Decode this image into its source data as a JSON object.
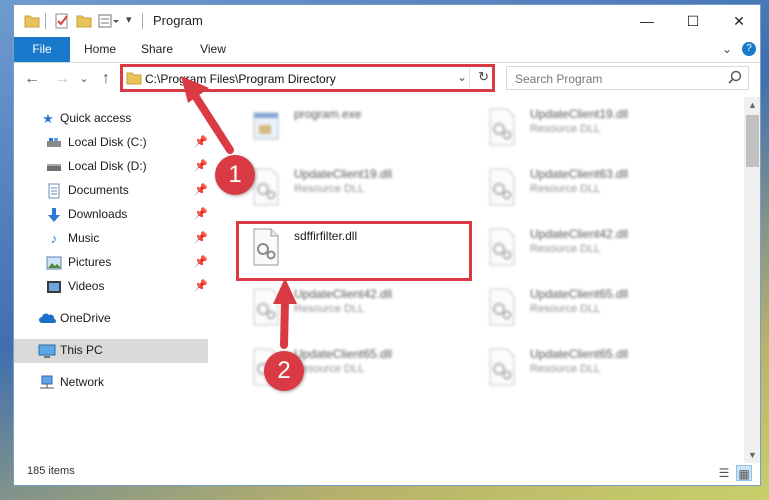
{
  "window": {
    "title": "Program",
    "controls": {
      "minimize": "—",
      "maximize": "☐",
      "close": "✕"
    }
  },
  "ribbon": {
    "tabs": [
      "File",
      "Home",
      "Share",
      "View"
    ],
    "expand": "⌄",
    "help": "?"
  },
  "nav": {
    "back": "←",
    "forward": "→",
    "recent": "⌄",
    "up": "↑",
    "address": "C:\\Program Files\\Program Directory",
    "dropdown": "⌄",
    "refresh": "↻",
    "search_placeholder": "Search Program"
  },
  "sidebar": {
    "items": [
      {
        "label": "Quick access",
        "icon": "star-icon"
      },
      {
        "label": "Local Disk (C:)",
        "icon": "drive-icon"
      },
      {
        "label": "Local Disk (D:)",
        "icon": "drive-icon"
      },
      {
        "label": "Documents",
        "icon": "documents-icon"
      },
      {
        "label": "Downloads",
        "icon": "download-icon"
      },
      {
        "label": "Music",
        "icon": "music-icon"
      },
      {
        "label": "Pictures",
        "icon": "pictures-icon"
      },
      {
        "label": "Videos",
        "icon": "videos-icon"
      },
      {
        "label": "OneDrive",
        "icon": "cloud-icon"
      },
      {
        "label": "This PC",
        "icon": "computer-icon"
      },
      {
        "label": "Network",
        "icon": "network-icon"
      }
    ]
  },
  "files": [
    {
      "name": "program.exe",
      "type": ""
    },
    {
      "name": "UpdateClient19.dll",
      "type": "Resource DLL"
    },
    {
      "name": "UpdateClient19.dll",
      "type": "Resource DLL"
    },
    {
      "name": "UpdateClient63.dll",
      "type": "Resource DLL"
    },
    {
      "name": "sdffirfilter.dll",
      "type": ""
    },
    {
      "name": "UpdateClient42.dll",
      "type": "Resource DLL"
    },
    {
      "name": "UpdateClient42.dll",
      "type": "Resource DLL"
    },
    {
      "name": "UpdateClient65.dll",
      "type": "Resource DLL"
    },
    {
      "name": "UpdateClient65.dll",
      "type": "Resource DLL"
    },
    {
      "name": "UpdateClient65.dll",
      "type": "Resource DLL"
    }
  ],
  "status": {
    "item_count": "185 items",
    "details_view": "☰",
    "large_icons_view": "▦"
  },
  "annotations": {
    "step1": "1",
    "step2": "2",
    "color": "#d93a44"
  },
  "colors": {
    "accent": "#1979ca",
    "highlight": "#d93a44"
  }
}
